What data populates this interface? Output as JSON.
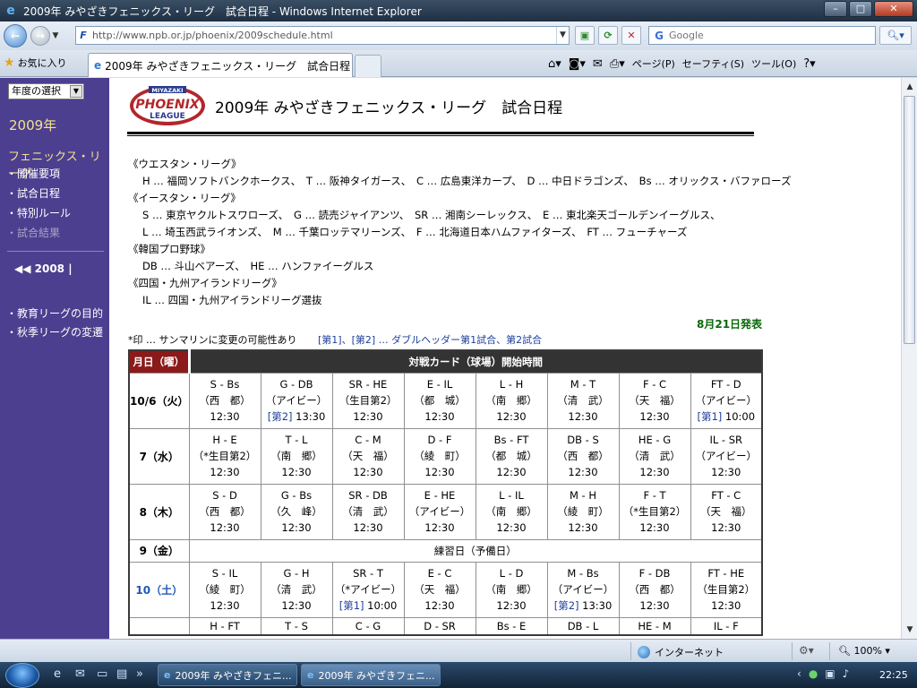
{
  "window": {
    "title": "2009年 みやざきフェニックス・リーグ　試合日程 - Windows Internet Explorer"
  },
  "address": {
    "url": "http://www.npb.or.jp/phoenix/2009schedule.html",
    "search_placeholder": "Google"
  },
  "favorites_label": "お気に入り",
  "tab": {
    "title": "2009年 みやざきフェニックス・リーグ　試合日程"
  },
  "commands": {
    "page": "ページ(P)",
    "safety": "セーフティ(S)",
    "tools": "ツール(O)"
  },
  "sidebar": {
    "year_select": "年度の選択",
    "year": "2009年",
    "heading": "フェニックス・リーグ",
    "items": [
      {
        "label": "・開催要項"
      },
      {
        "label": "・試合日程"
      },
      {
        "label": "・特別ルール"
      },
      {
        "label": "・試合結果"
      }
    ],
    "prev_year": "◀◀ 2008 |",
    "links": [
      {
        "label": "・教育リーグの目的"
      },
      {
        "label": "・秋季リーグの変遷"
      }
    ]
  },
  "page": {
    "logo_text_top": "MIYAZAKI",
    "logo_text_main": "PHOENIX",
    "logo_text_sub": "LEAGUE",
    "title": "2009年 みやざきフェニックス・リーグ　試合日程"
  },
  "legend": [
    {
      "kind": "h",
      "text": "《ウエスタン・リーグ》"
    },
    {
      "kind": "i",
      "text": "H … 福岡ソフトバンクホークス、　T … 阪神タイガース、　C … 広島東洋カープ、　D … 中日ドラゴンズ、　Bs … オリックス・バファローズ"
    },
    {
      "kind": "h",
      "text": "《イースタン・リーグ》"
    },
    {
      "kind": "i",
      "text": "S … 東京ヤクルトスワローズ、　G … 読売ジャイアンツ、　SR … 湘南シーレックス、　E … 東北楽天ゴールデンイーグルス、"
    },
    {
      "kind": "i",
      "text": "L … 埼玉西武ライオンズ、　M … 千葉ロッテマリーンズ、　F … 北海道日本ハムファイターズ、　FT … フューチャーズ"
    },
    {
      "kind": "h",
      "text": "《韓国プロ野球》"
    },
    {
      "kind": "i",
      "text": "DB … 斗山ベアーズ、　HE … ハンファイーグルス"
    },
    {
      "kind": "h",
      "text": "《四国・九州アイランドリーグ》"
    },
    {
      "kind": "i",
      "text": "IL … 四国・九州アイランドリーグ選抜"
    }
  ],
  "announcement": "8月21日発表",
  "note": {
    "asterisk": "*印 … サンマリンに変更の可能性あり",
    "doubleheader": "[第1]、[第2] … ダブルヘッダー第1試合、第2試合"
  },
  "schedule": {
    "header_date": "月日（曜）",
    "header_games": "対戦カード（球場）開始時間",
    "rows": [
      {
        "date": "10/6（火）",
        "blue": false,
        "games": [
          {
            "m": "S - Bs",
            "p": "（西　都）",
            "dh": "",
            "t": "12:30"
          },
          {
            "m": "G - DB",
            "p": "（アイビー）",
            "dh": "[第2]",
            "t": " 13:30"
          },
          {
            "m": "SR - HE",
            "p": "（生目第2）",
            "dh": "",
            "t": "12:30"
          },
          {
            "m": "E - IL",
            "p": "（都　城）",
            "dh": "",
            "t": "12:30"
          },
          {
            "m": "L - H",
            "p": "（南　郷）",
            "dh": "",
            "t": "12:30"
          },
          {
            "m": "M - T",
            "p": "（清　武）",
            "dh": "",
            "t": "12:30"
          },
          {
            "m": "F - C",
            "p": "（天　福）",
            "dh": "",
            "t": "12:30"
          },
          {
            "m": "FT - D",
            "p": "（アイビー）",
            "dh": "[第1]",
            "t": " 10:00"
          }
        ]
      },
      {
        "date": "7（水）",
        "blue": false,
        "games": [
          {
            "m": "H - E",
            "p": "（*生目第2）",
            "dh": "",
            "t": "12:30"
          },
          {
            "m": "T - L",
            "p": "（南　郷）",
            "dh": "",
            "t": "12:30"
          },
          {
            "m": "C - M",
            "p": "（天　福）",
            "dh": "",
            "t": "12:30"
          },
          {
            "m": "D - F",
            "p": "（綾　町）",
            "dh": "",
            "t": "12:30"
          },
          {
            "m": "Bs - FT",
            "p": "（都　城）",
            "dh": "",
            "t": "12:30"
          },
          {
            "m": "DB - S",
            "p": "（西　都）",
            "dh": "",
            "t": "12:30"
          },
          {
            "m": "HE - G",
            "p": "（清　武）",
            "dh": "",
            "t": "12:30"
          },
          {
            "m": "IL - SR",
            "p": "（アイビー）",
            "dh": "",
            "t": "12:30"
          }
        ]
      },
      {
        "date": "8（木）",
        "blue": false,
        "games": [
          {
            "m": "S - D",
            "p": "（西　都）",
            "dh": "",
            "t": "12:30"
          },
          {
            "m": "G - Bs",
            "p": "（久　峰）",
            "dh": "",
            "t": "12:30"
          },
          {
            "m": "SR - DB",
            "p": "（清　武）",
            "dh": "",
            "t": "12:30"
          },
          {
            "m": "E - HE",
            "p": "（アイビー）",
            "dh": "",
            "t": "12:30"
          },
          {
            "m": "L - IL",
            "p": "（南　郷）",
            "dh": "",
            "t": "12:30"
          },
          {
            "m": "M - H",
            "p": "（綾　町）",
            "dh": "",
            "t": "12:30"
          },
          {
            "m": "F - T",
            "p": "（*生目第2）",
            "dh": "",
            "t": "12:30"
          },
          {
            "m": "FT - C",
            "p": "（天　福）",
            "dh": "",
            "t": "12:30"
          }
        ]
      }
    ],
    "rest_row": {
      "date": "9（金）",
      "text": "練習日（予備日）"
    },
    "rows2": [
      {
        "date": "10（土）",
        "blue": true,
        "games": [
          {
            "m": "S - IL",
            "p": "（綾　町）",
            "dh": "",
            "t": "12:30"
          },
          {
            "m": "G - H",
            "p": "（清　武）",
            "dh": "",
            "t": "12:30"
          },
          {
            "m": "SR - T",
            "p": "（*アイビー）",
            "dh": "[第1]",
            "t": " 10:00"
          },
          {
            "m": "E - C",
            "p": "（天　福）",
            "dh": "",
            "t": "12:30"
          },
          {
            "m": "L - D",
            "p": "（南　郷）",
            "dh": "",
            "t": "12:30"
          },
          {
            "m": "M - Bs",
            "p": "（アイビー）",
            "dh": "[第2]",
            "t": " 13:30"
          },
          {
            "m": "F - DB",
            "p": "（西　都）",
            "dh": "",
            "t": "12:30"
          },
          {
            "m": "FT - HE",
            "p": "（生目第2）",
            "dh": "",
            "t": "12:30"
          }
        ]
      }
    ],
    "partial_row": [
      "H - FT",
      "T - S",
      "C - G",
      "D - SR",
      "Bs - E",
      "DB - L",
      "HE - M",
      "IL - F"
    ]
  },
  "status": {
    "zone": "インターネット",
    "zoom": "100%"
  },
  "taskbar": {
    "tasks": [
      {
        "label": "2009年 みやざきフェニ..."
      },
      {
        "label": "2009年 みやざきフェニ..."
      }
    ],
    "clock": "22:25"
  }
}
